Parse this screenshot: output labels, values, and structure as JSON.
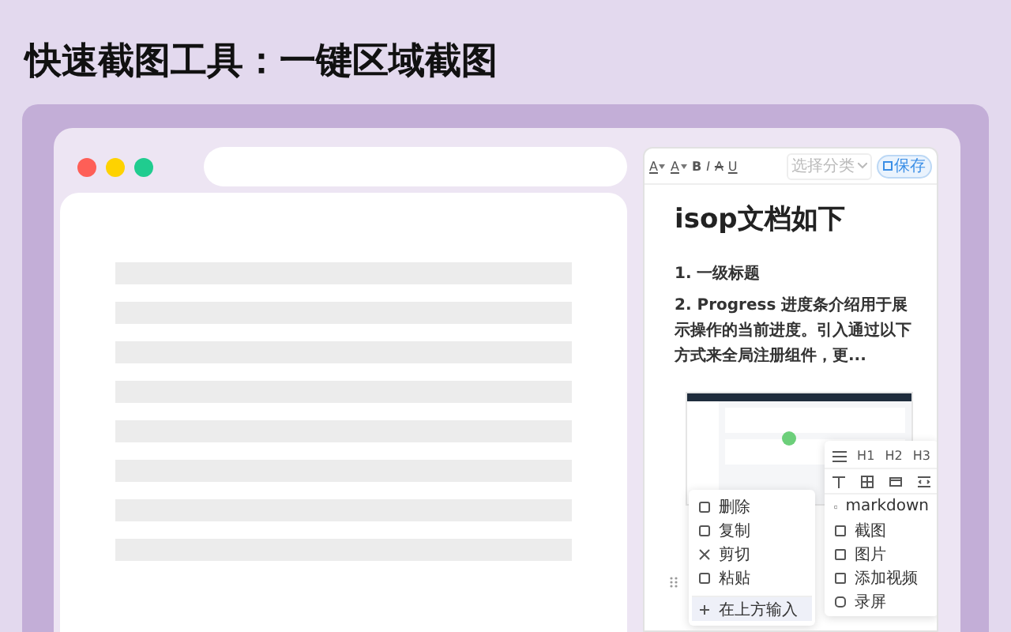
{
  "headline": "快速截图工具：一键区域截图",
  "browser": {
    "dots": [
      {
        "color": "#fe5f57"
      },
      {
        "color": "#fed200"
      },
      {
        "color": "#20cc8f"
      }
    ]
  },
  "editor": {
    "toolbar": [
      {
        "label": "A",
        "kind": "color",
        "caret": true
      },
      {
        "label": "A",
        "kind": "highlight",
        "caret": true
      },
      {
        "label": "B",
        "kind": "bold",
        "caret": false
      },
      {
        "label": "I",
        "kind": "italic",
        "caret": false
      },
      {
        "label": "A",
        "kind": "strike",
        "caret": false
      },
      {
        "label": "U",
        "kind": "underline",
        "caret": false
      }
    ],
    "category": {
      "placeholder": "选择分类"
    },
    "save_button": "保存",
    "title": "isop文档如下",
    "heading": "1. 一级标题",
    "paragraph": "2. Progress 进度条介绍用于展示操作的当前进度。引入通过以下方式来全局注册组件，更...",
    "context_menu": {
      "items": [
        {
          "label": "删除",
          "kind": "delete"
        },
        {
          "label": "复制",
          "kind": "copy"
        },
        {
          "label": "剪切",
          "kind": "cut"
        },
        {
          "label": "粘贴",
          "kind": "paste"
        }
      ],
      "insert": {
        "label": "在上方输入",
        "selected": true
      }
    },
    "block_menu": {
      "headings": [
        "H1",
        "H2",
        "H3"
      ],
      "items": [
        {
          "label": "markdown",
          "kind": "markdown"
        },
        {
          "label": "截图",
          "kind": "screenshot"
        },
        {
          "label": "图片",
          "kind": "image"
        },
        {
          "label": "添加视频",
          "kind": "video"
        },
        {
          "label": "录屏",
          "kind": "record"
        }
      ]
    }
  }
}
